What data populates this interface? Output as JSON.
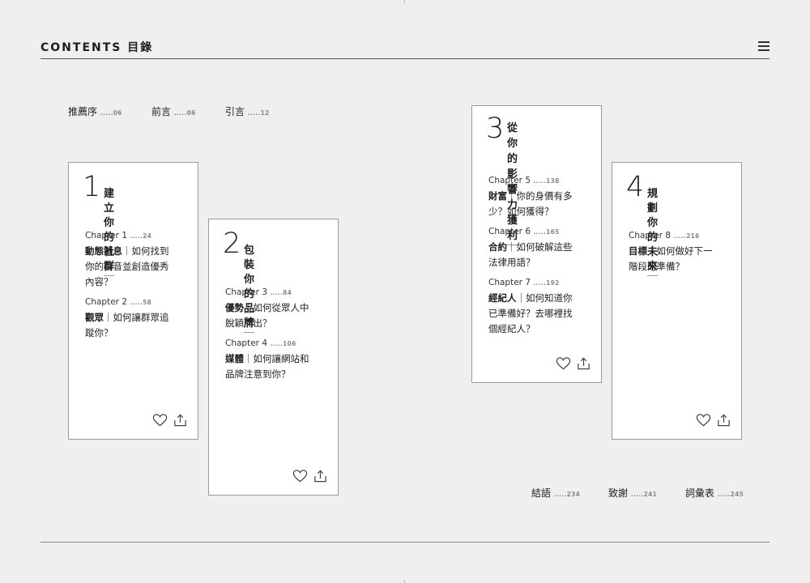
{
  "header": {
    "title": "CONTENTS 目錄"
  },
  "front_matter": [
    {
      "title": "推薦序",
      "page": ".....06"
    },
    {
      "title": "前言",
      "page": ".....06"
    },
    {
      "title": "引言",
      "page": ".....12"
    }
  ],
  "back_matter": [
    {
      "title": "結語",
      "page": ".....234"
    },
    {
      "title": "致謝",
      "page": ".....241"
    },
    {
      "title": "詞彙表",
      "page": ".....245"
    }
  ],
  "parts": [
    {
      "number": "1",
      "title": "建立你的社群",
      "chapters": [
        {
          "label": "Chapter 1",
          "page": ".....24",
          "keyword": "動態消息",
          "sep": "｜",
          "lines": [
            "如何找到",
            "你的聲音並創造優秀",
            "內容？"
          ]
        },
        {
          "label": "Chapter 2",
          "page": ".....58",
          "keyword": "觀眾",
          "sep": "｜",
          "lines": [
            "如何讓群眾追",
            "蹤你？"
          ]
        }
      ]
    },
    {
      "number": "2",
      "title": "包裝你的品牌",
      "chapters": [
        {
          "label": "Chapter 3",
          "page": ".....84",
          "keyword": "優勢",
          "sep": "｜",
          "lines": [
            "如何從眾人中",
            "脫穎而出？"
          ]
        },
        {
          "label": "Chapter 4",
          "page": ".....106",
          "keyword": "媒體",
          "sep": "｜",
          "lines": [
            "如何讓網站和",
            "品牌注意到你？"
          ]
        }
      ]
    },
    {
      "number": "3",
      "title_lines": [
        "從你的影響力",
        "獲利"
      ],
      "chapters": [
        {
          "label": "Chapter 5",
          "page": ".....138",
          "keyword": "財富",
          "sep": "｜",
          "lines": [
            "你的身價有多",
            "少？如何獲得？"
          ]
        },
        {
          "label": "Chapter 6",
          "page": ".....165",
          "keyword": "合約",
          "sep": "｜",
          "lines": [
            "如何破解這些",
            "法律用語？"
          ]
        },
        {
          "label": "Chapter 7",
          "page": ".....192",
          "keyword": "經紀人",
          "sep": "｜",
          "lines": [
            "如何知道你",
            "已準備好？去哪裡找",
            "個經紀人？"
          ]
        }
      ]
    },
    {
      "number": "4",
      "title": "規劃你的未來",
      "chapters": [
        {
          "label": "Chapter 8",
          "page": ".....216",
          "keyword": "目標",
          "sep": "｜",
          "lines": [
            "如何做好下一",
            "階段的準備？"
          ]
        }
      ]
    }
  ],
  "icons": {
    "menu": "hamburger-menu-icon",
    "like": "heart-icon",
    "share": "share-icon"
  },
  "colors": {
    "background": "#efefef",
    "card": "#ffffff",
    "text": "#1e1e1e",
    "border": "#9a9a9a"
  }
}
